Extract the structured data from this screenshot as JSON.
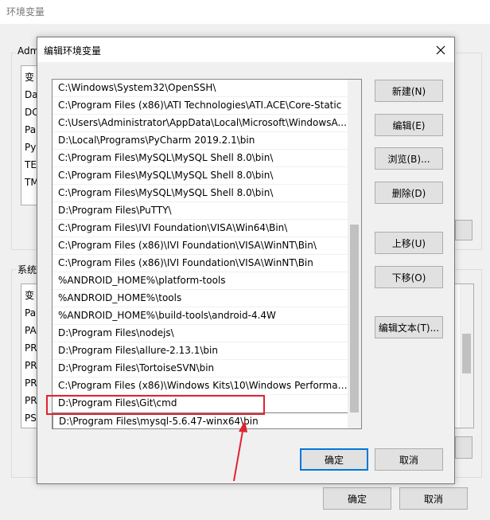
{
  "background_window": {
    "title": "环境变量",
    "user_group_label": "Adm",
    "system_group_label": "系统",
    "user_list_fragments": [
      "变",
      "Da",
      "DC",
      "Pa",
      "Py",
      "TE",
      "TM"
    ],
    "system_list_fragments": [
      "变",
      "Pa",
      "PA",
      "PR",
      "PR",
      "PR",
      "PR",
      "PS"
    ],
    "ok_label": "确定",
    "cancel_label": "取消"
  },
  "dialog": {
    "title": "编辑环境变量",
    "close_icon": "close-icon",
    "entries": [
      "C:\\Windows\\System32\\OpenSSH\\",
      "C:\\Program Files (x86)\\ATI Technologies\\ATI.ACE\\Core-Static",
      "C:\\Users\\Administrator\\AppData\\Local\\Microsoft\\WindowsA...",
      "D:\\Local\\Programs\\PyCharm 2019.2.1\\bin",
      "C:\\Program Files\\MySQL\\MySQL Shell 8.0\\bin\\",
      "C:\\Program Files\\MySQL\\MySQL Shell 8.0\\bin\\",
      "C:\\Program Files\\MySQL\\MySQL Shell 8.0\\bin\\",
      "D:\\Program Files\\PuTTY\\",
      "C:\\Program Files\\IVI Foundation\\VISA\\Win64\\Bin\\",
      "C:\\Program Files (x86)\\IVI Foundation\\VISA\\WinNT\\Bin\\",
      "C:\\Program Files (x86)\\IVI Foundation\\VISA\\WinNT\\Bin",
      "%ANDROID_HOME%\\platform-tools",
      "%ANDROID_HOME%\\tools",
      "%ANDROID_HOME%\\build-tools\\android-4.4W",
      "D:\\Program Files\\nodejs\\",
      "D:\\Program Files\\allure-2.13.1\\bin",
      "D:\\Program Files\\TortoiseSVN\\bin",
      "C:\\Program Files (x86)\\Windows Kits\\10\\Windows Performan...",
      "D:\\Program Files\\Git\\cmd",
      "D:\\Program Files\\mysql-5.6.47-winx64\\bin"
    ],
    "editing_index": 19,
    "buttons": {
      "new": "新建(N)",
      "edit": "编辑(E)",
      "browse": "浏览(B)...",
      "delete": "删除(D)",
      "move_up": "上移(U)",
      "move_down": "下移(O)",
      "edit_text": "编辑文本(T)...",
      "ok": "确定",
      "cancel": "取消"
    }
  },
  "annotation": {
    "color": "#e0242f"
  }
}
